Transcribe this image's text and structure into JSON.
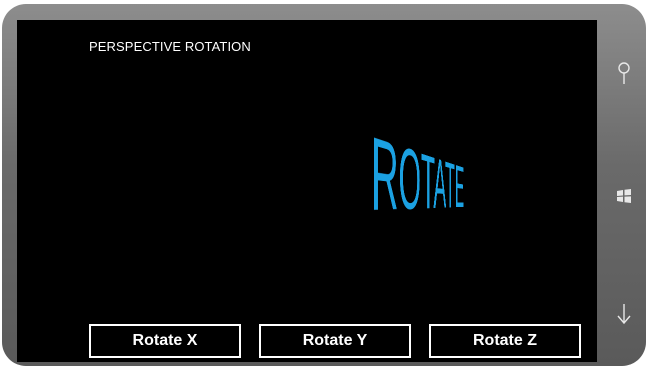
{
  "app": {
    "title": "PERSPECTIVE ROTATION",
    "rotate_text": "ROTATE"
  },
  "buttons": [
    {
      "label": "Rotate X"
    },
    {
      "label": "Rotate Y"
    },
    {
      "label": "Rotate Z"
    }
  ],
  "hardware_buttons": {
    "search": "search-icon",
    "start": "windows-logo-icon",
    "back": "back-arrow-icon"
  },
  "colors": {
    "accent": "#1ba1e2",
    "background": "#000000",
    "foreground": "#ffffff",
    "bezel": "#6a6a6a"
  }
}
